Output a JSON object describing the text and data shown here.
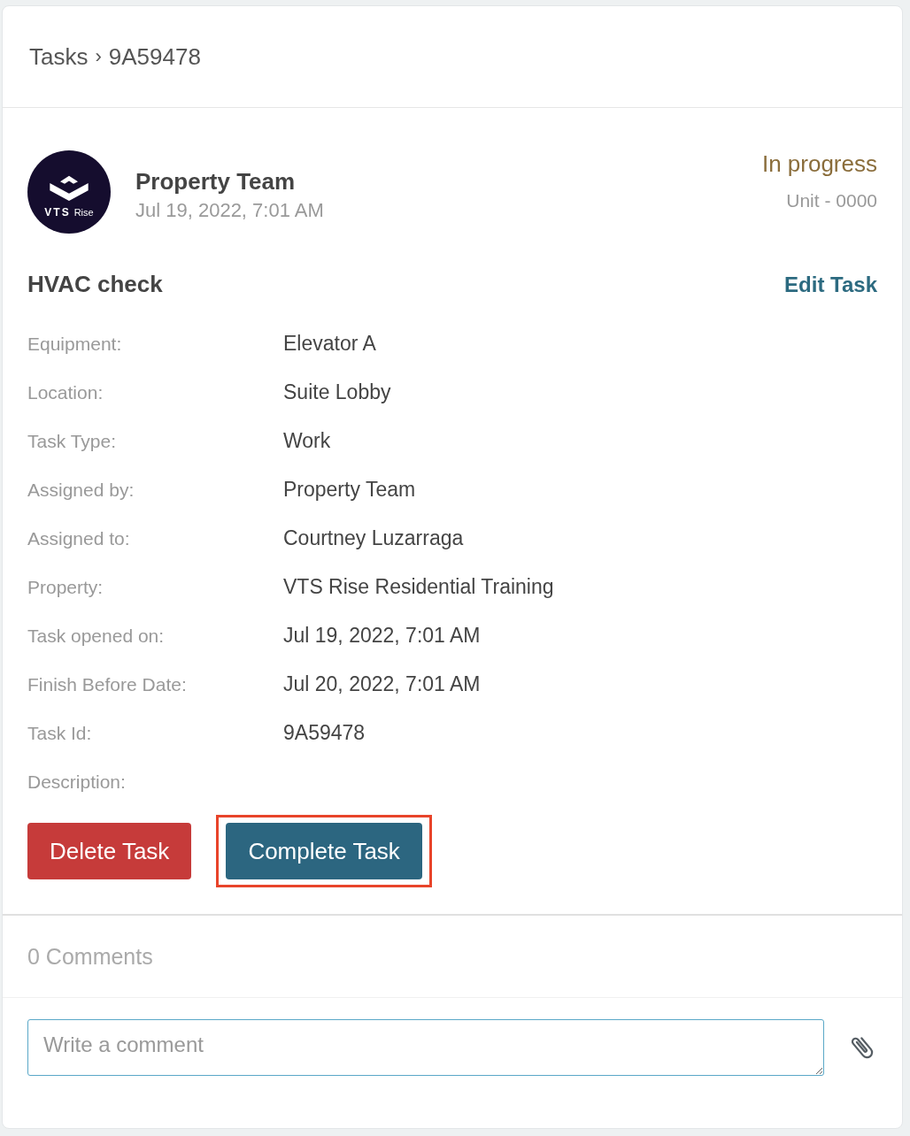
{
  "breadcrumb": {
    "parent": "Tasks",
    "separator": "›",
    "current": "9A59478"
  },
  "author": {
    "avatar_text": "VTS",
    "avatar_subtext": "Rise",
    "name": "Property Team",
    "date": "Jul 19, 2022, 7:01 AM"
  },
  "status": {
    "label": "In progress",
    "unit": "Unit - 0000"
  },
  "task": {
    "title": "HVAC check",
    "edit_link": "Edit Task"
  },
  "fields": [
    {
      "label": "Equipment:",
      "value": "Elevator A"
    },
    {
      "label": "Location:",
      "value": "Suite Lobby"
    },
    {
      "label": "Task Type:",
      "value": "Work"
    },
    {
      "label": "Assigned by:",
      "value": "Property Team"
    },
    {
      "label": "Assigned to:",
      "value": "Courtney Luzarraga"
    },
    {
      "label": "Property:",
      "value": "VTS Rise Residential Training"
    },
    {
      "label": "Task opened on:",
      "value": "Jul 19, 2022, 7:01 AM"
    },
    {
      "label": "Finish Before Date:",
      "value": "Jul 20, 2022, 7:01 AM"
    },
    {
      "label": "Task Id:",
      "value": "9A59478"
    },
    {
      "label": "Description:"
    }
  ],
  "buttons": [
    {
      "label": "Delete Task",
      "kind": "danger",
      "highlighted": false
    },
    {
      "label": "Complete Task",
      "kind": "primary",
      "highlighted": true
    }
  ],
  "comments": {
    "count": "0 Comments",
    "placeholder": "Write a comment"
  }
}
